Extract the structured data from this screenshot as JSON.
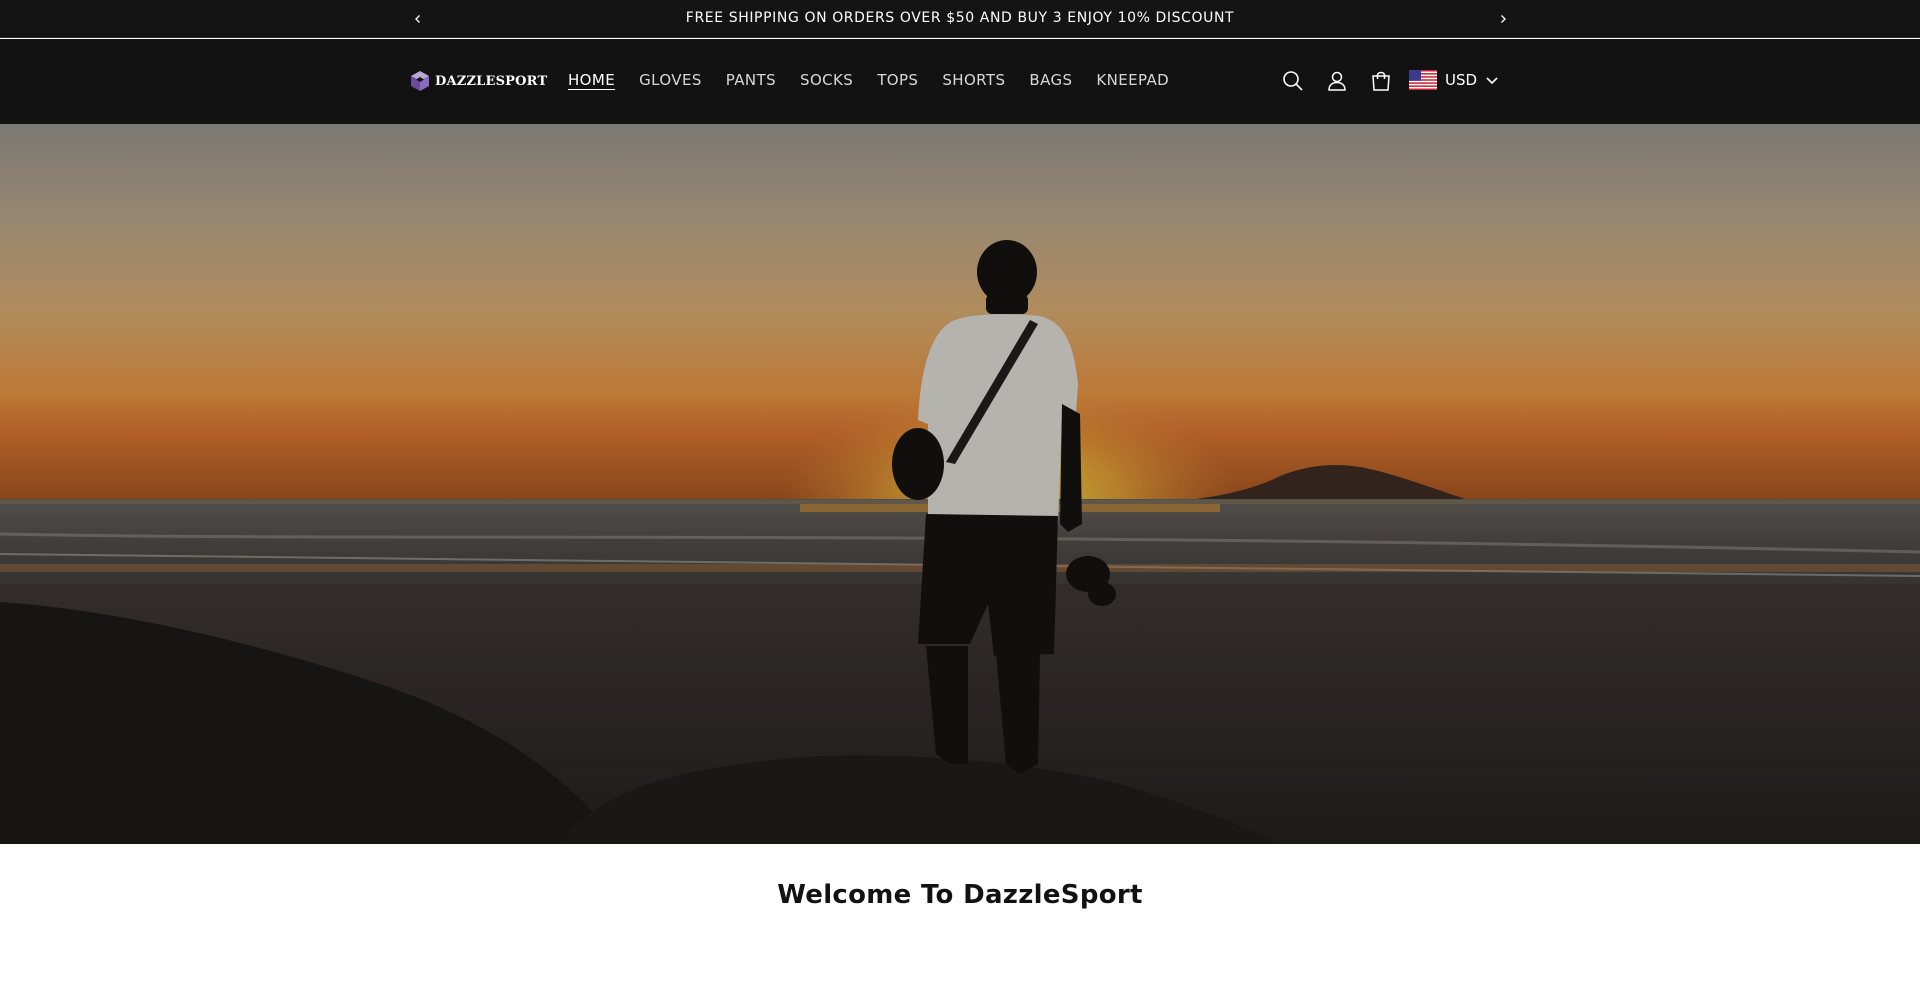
{
  "announcement": {
    "text": "FREE SHIPPING ON ORDERS OVER $50 AND BUY 3 ENJOY 10% DISCOUNT",
    "prev_icon": "chevron-left-icon",
    "next_icon": "chevron-right-icon"
  },
  "header": {
    "logo_text": "DAZZLESPORT",
    "nav": [
      {
        "label": "HOME",
        "active": true
      },
      {
        "label": "GLOVES",
        "active": false
      },
      {
        "label": "PANTS",
        "active": false
      },
      {
        "label": "SOCKS",
        "active": false
      },
      {
        "label": "TOPS",
        "active": false
      },
      {
        "label": "SHORTS",
        "active": false
      },
      {
        "label": "BAGS",
        "active": false
      },
      {
        "label": "KNEEPAD",
        "active": false
      }
    ],
    "icons": [
      "search-icon",
      "account-icon",
      "cart-icon"
    ],
    "currency": {
      "code": "USD",
      "flag": "us-flag-icon"
    }
  },
  "hero": {
    "image": "silhouette-at-sunset-beach"
  },
  "welcome": {
    "title": "Welcome To DazzleSport"
  },
  "colors": {
    "header_bg": "#121212",
    "announcement_bg": "#141414",
    "text_light": "#ffffff",
    "heading_dark": "#121212"
  }
}
